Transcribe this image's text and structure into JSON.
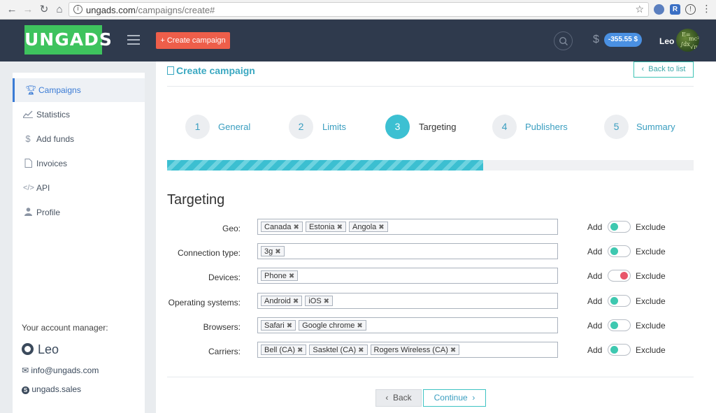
{
  "browser": {
    "url_host": "ungads.com",
    "url_path": "/campaigns/create#"
  },
  "header": {
    "logo": "UNGADS",
    "create_button": "+ Create campaign",
    "currency_icon": "$",
    "balance": "-355.55 $",
    "user": "Leo"
  },
  "sidebar": {
    "items": [
      {
        "label": "Campaigns",
        "icon": "trophy-icon"
      },
      {
        "label": "Statistics",
        "icon": "chart-icon"
      },
      {
        "label": "Add funds",
        "icon": "dollar-icon"
      },
      {
        "label": "Invoices",
        "icon": "document-icon"
      },
      {
        "label": "API",
        "icon": "code-icon"
      },
      {
        "label": "Profile",
        "icon": "user-icon"
      }
    ],
    "account_manager_label": "Your account manager:",
    "manager_name": "Leo",
    "manager_email": "info@ungads.com",
    "manager_skype": "ungads.sales"
  },
  "main": {
    "title": "Create campaign",
    "back_to_list": "Back to list",
    "steps": [
      {
        "num": "1",
        "label": "General"
      },
      {
        "num": "2",
        "label": "Limits"
      },
      {
        "num": "3",
        "label": "Targeting"
      },
      {
        "num": "4",
        "label": "Publishers"
      },
      {
        "num": "5",
        "label": "Summary"
      }
    ],
    "active_step": 3,
    "progress_fraction": 0.6,
    "section_title": "Targeting",
    "rows": [
      {
        "label": "Geo:",
        "tags": [
          "Canada",
          "Estonia",
          "Angola"
        ],
        "mode": "add"
      },
      {
        "label": "Connection type:",
        "tags": [
          "3g"
        ],
        "mode": "add"
      },
      {
        "label": "Devices:",
        "tags": [
          "Phone"
        ],
        "mode": "exclude"
      },
      {
        "label": "Operating systems:",
        "tags": [
          "Android",
          "iOS"
        ],
        "mode": "add"
      },
      {
        "label": "Browsers:",
        "tags": [
          "Safari",
          "Google chrome"
        ],
        "mode": "add"
      },
      {
        "label": "Carriers:",
        "tags": [
          "Bell (CA)",
          "Sasktel (CA)",
          "Rogers Wireless (CA)"
        ],
        "mode": "add"
      }
    ],
    "add_label": "Add",
    "exclude_label": "Exclude",
    "back_button": "Back",
    "continue_button": "Continue"
  },
  "colors": {
    "header_bg": "#2f3a4d",
    "logo_green": "#3ec35e",
    "create_red": "#ee5e4a",
    "accent_teal": "#3cc0d2",
    "toggle_add": "#3ec8b0",
    "toggle_exclude": "#e8566a"
  }
}
